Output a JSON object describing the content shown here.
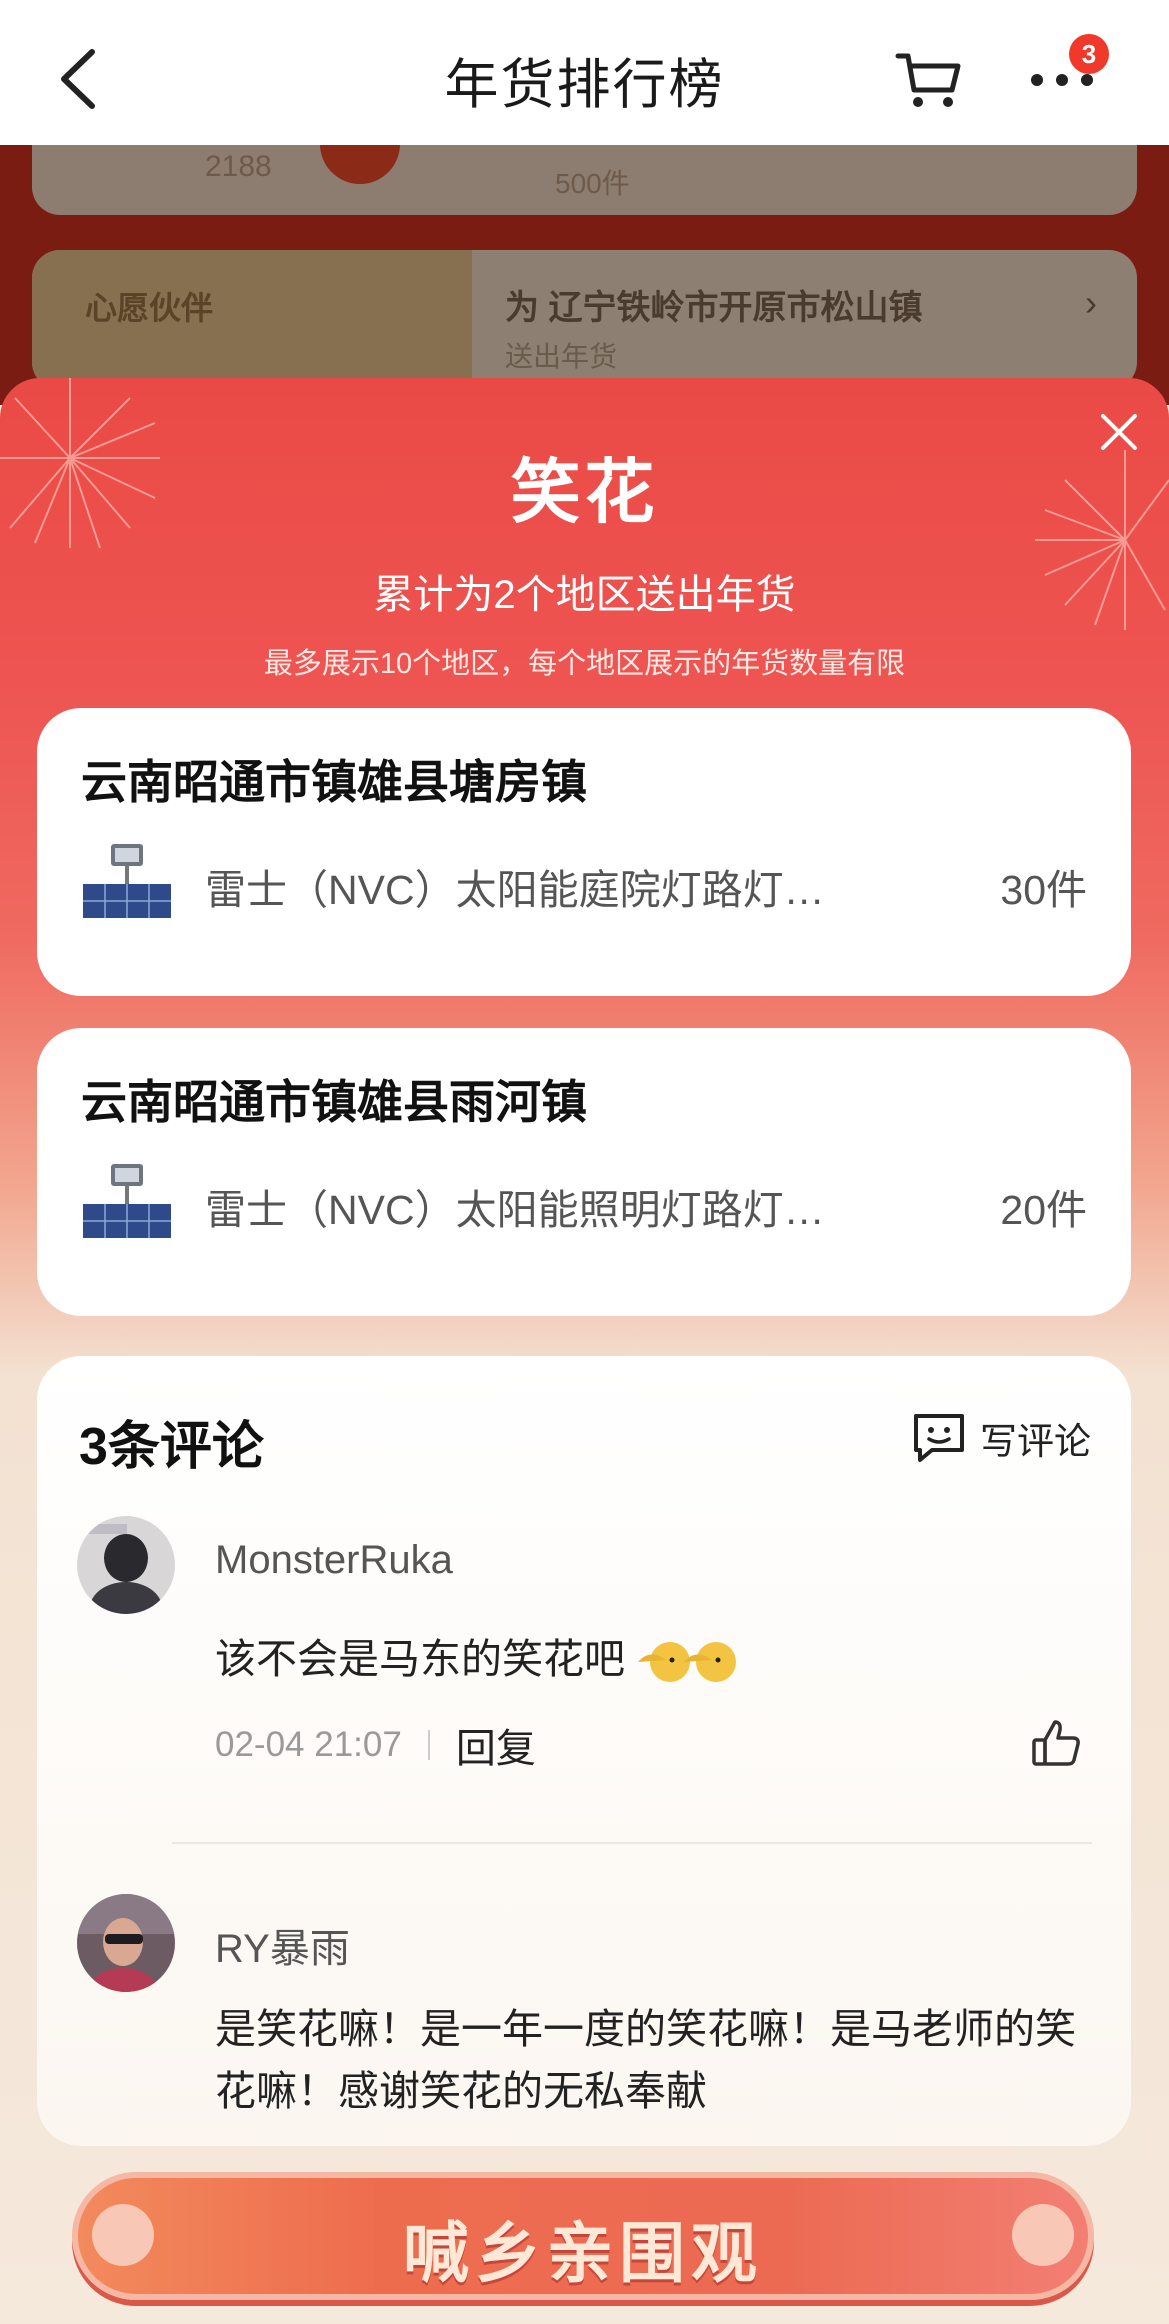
{
  "nav": {
    "title": "年货排行榜",
    "badge_count": "3",
    "back_icon": "chevron-left-icon",
    "cart_icon": "cart-icon",
    "more_icon": "more-dots-icon"
  },
  "background": {
    "card1_number": "2188",
    "card1_count": "500件",
    "partner_label": "心愿伙伴",
    "card2_text": "为 辽宁铁岭市开原市松山镇",
    "card2_sub": "送出年货",
    "card2_arrow": "›"
  },
  "sheet": {
    "title": "笑花",
    "subtitle": "累计为2个地区送出年货",
    "note": "最多展示10个地区，每个地区展示的年货数量有限"
  },
  "regions": [
    {
      "name": "云南昭通市镇雄县塘房镇",
      "product": "雷士（NVC）太阳能庭院灯路灯…",
      "quantity": "30件"
    },
    {
      "name": "云南昭通市镇雄县雨河镇",
      "product": "雷士（NVC）太阳能照明灯路灯…",
      "quantity": "20件"
    }
  ],
  "comments": {
    "title": "3条评论",
    "write_label": "写评论",
    "items": [
      {
        "user": "MonsterRuka",
        "text": "该不会是马东的笑花吧",
        "time": "02-04 21:07",
        "reply": "回复"
      },
      {
        "user": "RY暴雨",
        "text": "是笑花嘛！是一年一度的笑花嘛！是马老师的笑花嘛！感谢笑花的无私奉献"
      }
    ]
  },
  "cta": {
    "label": "喊乡亲围观"
  },
  "colors": {
    "header_red": "#ea4a45",
    "badge_red": "#f0392b",
    "cta_orange": "#ee6c4e",
    "sheet_cream": "#f5e9dc"
  }
}
